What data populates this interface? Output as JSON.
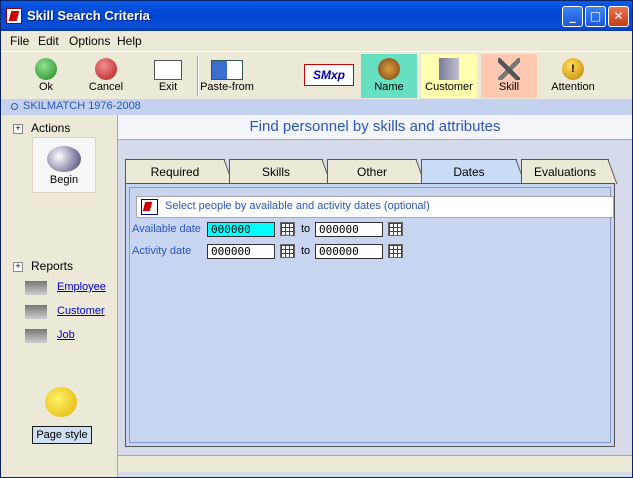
{
  "window": {
    "title": "Skill Search Criteria"
  },
  "menu": [
    "File",
    "Edit",
    "Options",
    "Help"
  ],
  "toolbar": {
    "ok": "Ok",
    "cancel": "Cancel",
    "exit": "Exit",
    "paste_from": "Paste-from",
    "logo": "SMxp",
    "name": "Name",
    "customer": "Customer",
    "skill": "Skill",
    "attention": "Attention"
  },
  "strip": "SKILMATCH 1976-2008",
  "sidebar": {
    "actions": "Actions",
    "begin": "Begin",
    "reports": "Reports",
    "links": [
      "Employee",
      "Customer",
      "Job"
    ],
    "page_style": "Page style"
  },
  "main": {
    "heading": "Find personnel by skills and attributes",
    "tabs": [
      "Required",
      "Skills",
      "Other",
      "Dates",
      "Evaluations"
    ],
    "active_tab": "Dates",
    "hint": "Select people by available and activity dates (optional)",
    "rows": [
      {
        "label": "Available date",
        "from": "000000",
        "to_label": "to",
        "to": "000000"
      },
      {
        "label": "Activity date",
        "from": "000000",
        "to_label": "to",
        "to": "000000"
      }
    ]
  }
}
